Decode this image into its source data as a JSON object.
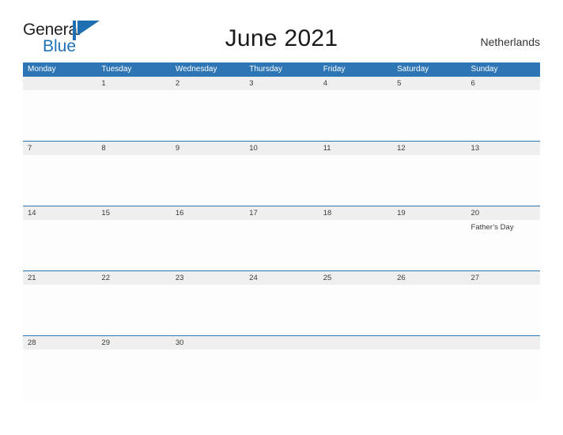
{
  "brand": {
    "name_part1": "General",
    "name_part2": "Blue",
    "flag_icon": "brand-flag-icon",
    "color_dark": "#231f20",
    "color_blue": "#2072b8"
  },
  "header": {
    "title": "June 2021",
    "location": "Netherlands"
  },
  "theme": {
    "header_blue": "#2e75b6",
    "band_grey": "#efefef",
    "rule_blue": "#2e75b6",
    "text_dark": "#3a3a3a"
  },
  "calendar": {
    "weekdays": [
      "Monday",
      "Tuesday",
      "Wednesday",
      "Thursday",
      "Friday",
      "Saturday",
      "Sunday"
    ],
    "weeks": [
      [
        {
          "day": ""
        },
        {
          "day": "1"
        },
        {
          "day": "2"
        },
        {
          "day": "3"
        },
        {
          "day": "4"
        },
        {
          "day": "5"
        },
        {
          "day": "6"
        }
      ],
      [
        {
          "day": "7"
        },
        {
          "day": "8"
        },
        {
          "day": "9"
        },
        {
          "day": "10"
        },
        {
          "day": "11"
        },
        {
          "day": "12"
        },
        {
          "day": "13"
        }
      ],
      [
        {
          "day": "14"
        },
        {
          "day": "15"
        },
        {
          "day": "16"
        },
        {
          "day": "17"
        },
        {
          "day": "18"
        },
        {
          "day": "19"
        },
        {
          "day": "20",
          "event": "Father’s Day"
        }
      ],
      [
        {
          "day": "21"
        },
        {
          "day": "22"
        },
        {
          "day": "23"
        },
        {
          "day": "24"
        },
        {
          "day": "25"
        },
        {
          "day": "26"
        },
        {
          "day": "27"
        }
      ],
      [
        {
          "day": "28"
        },
        {
          "day": "29"
        },
        {
          "day": "30"
        },
        {
          "day": ""
        },
        {
          "day": ""
        },
        {
          "day": ""
        },
        {
          "day": ""
        }
      ]
    ]
  }
}
